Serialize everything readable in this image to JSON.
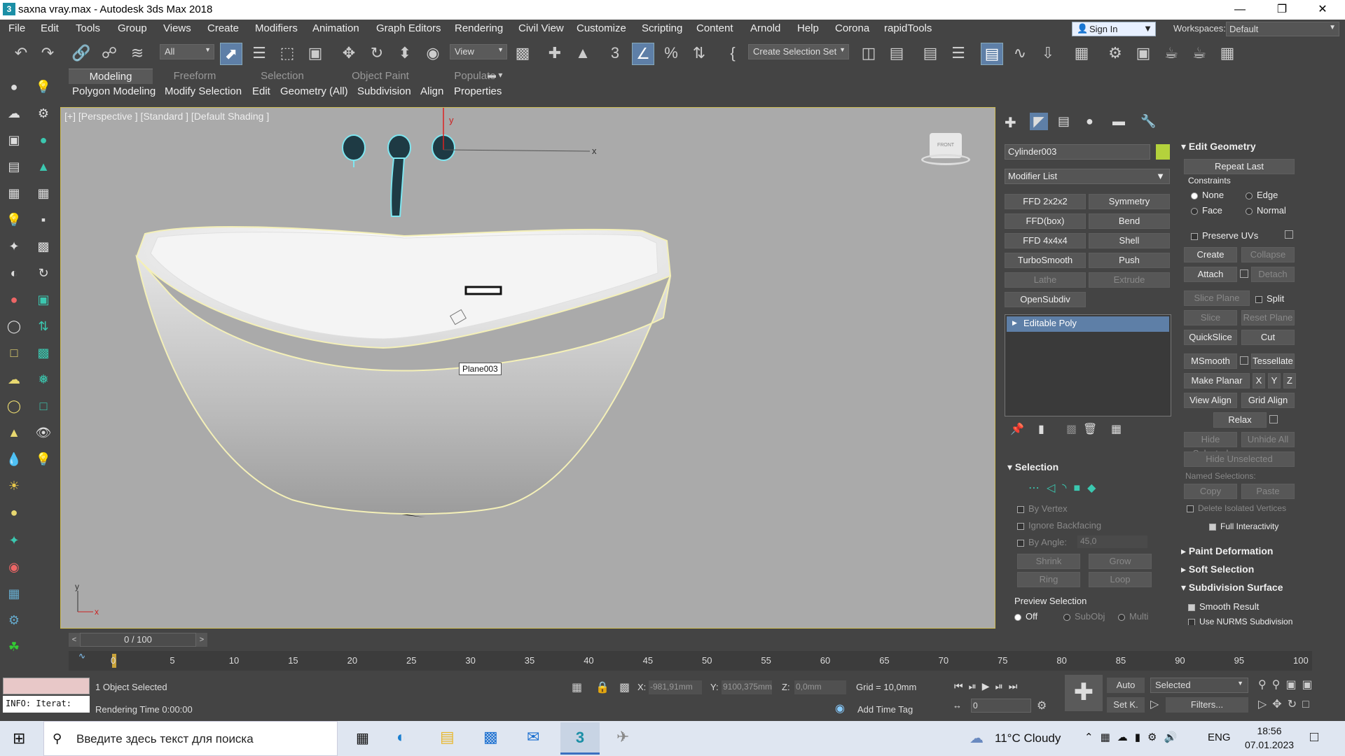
{
  "window": {
    "title": "saxna vray.max - Autodesk 3ds Max 2018",
    "app_logo": "3"
  },
  "menu": [
    "File",
    "Edit",
    "Tools",
    "Group",
    "Views",
    "Create",
    "Modifiers",
    "Animation",
    "Graph Editors",
    "Rendering",
    "Civil View",
    "Customize",
    "Scripting",
    "Content",
    "Arnold",
    "Help",
    "Corona",
    "rapidTools"
  ],
  "signin": "Sign In",
  "workspaces": {
    "label": "Workspaces:",
    "value": "Default"
  },
  "toolbar": {
    "filter": "All",
    "view": "View",
    "selection_set": "Create Selection Set"
  },
  "ribbon": {
    "tabs": [
      "Modeling",
      "Freeform",
      "Selection",
      "Object Paint",
      "Populate"
    ],
    "active": "Modeling",
    "subtabs": [
      "Polygon Modeling",
      "Modify Selection",
      "Edit",
      "Geometry (All)",
      "Subdivision",
      "Align",
      "Properties"
    ]
  },
  "viewport": {
    "label": "[+] [Perspective ] [Standard ] [Default Shading ]",
    "tooltip": "Plane003",
    "axis_y": "y",
    "axis_x": "x",
    "gizmo_y": "y",
    "gizmo_x": "x",
    "viewcube": "FRONT"
  },
  "panel": {
    "object_name": "Cylinder003",
    "object_color": "#b4d23c",
    "modifier_list": "Modifier List",
    "modifier_buttons": [
      {
        "label": "FFD 2x2x2",
        "enabled": true
      },
      {
        "label": "Symmetry",
        "enabled": true
      },
      {
        "label": "FFD(box)",
        "enabled": true
      },
      {
        "label": "Bend",
        "enabled": true
      },
      {
        "label": "FFD 4x4x4",
        "enabled": true
      },
      {
        "label": "Shell",
        "enabled": true
      },
      {
        "label": "TurboSmooth",
        "enabled": true
      },
      {
        "label": "Push",
        "enabled": true
      },
      {
        "label": "Lathe",
        "enabled": false
      },
      {
        "label": "Extrude",
        "enabled": false
      },
      {
        "label": "OpenSubdiv",
        "enabled": true
      }
    ],
    "stack_item": "Editable Poly",
    "selection": {
      "title": "Selection",
      "by_vertex": "By Vertex",
      "ignore_backfacing": "Ignore Backfacing",
      "by_angle": "By Angle:",
      "angle": "45,0",
      "shrink": "Shrink",
      "grow": "Grow",
      "ring": "Ring",
      "loop": "Loop",
      "preview": "Preview Selection",
      "off": "Off",
      "subobj": "SubObj",
      "multi": "Multi"
    },
    "edit_geometry": {
      "title": "Edit Geometry",
      "repeat_last": "Repeat Last",
      "constraints": "Constraints",
      "none": "None",
      "edge": "Edge",
      "face": "Face",
      "normal": "Normal",
      "preserve_uvs": "Preserve UVs",
      "create": "Create",
      "collapse": "Collapse",
      "attach": "Attach",
      "detach": "Detach",
      "slice_plane": "Slice Plane",
      "split": "Split",
      "slice": "Slice",
      "reset_plane": "Reset Plane",
      "quickslice": "QuickSlice",
      "cut": "Cut",
      "msmooth": "MSmooth",
      "tessellate": "Tessellate",
      "make_planar": "Make Planar",
      "x": "X",
      "y": "Y",
      "z": "Z",
      "view_align": "View Align",
      "grid_align": "Grid Align",
      "relax": "Relax",
      "hide_selected": "Hide Selected",
      "unhide_all": "Unhide All",
      "hide_unselected": "Hide Unselected",
      "named_selections": "Named Selections:",
      "copy": "Copy",
      "paste": "Paste",
      "delete_isolated": "Delete Isolated Vertices",
      "full_interactivity": "Full Interactivity"
    },
    "rollouts": [
      "Paint Deformation",
      "Soft Selection",
      "Subdivision Surface"
    ],
    "smooth_result": "Smooth Result",
    "nurms_partial": "Use NURMS Subdivision"
  },
  "timeline": {
    "frame": "0 / 100",
    "ticks": [
      "0",
      "5",
      "10",
      "15",
      "20",
      "25",
      "30",
      "35",
      "40",
      "45",
      "50",
      "55",
      "60",
      "65",
      "70",
      "75",
      "80",
      "85",
      "90",
      "95",
      "100"
    ]
  },
  "status": {
    "selected": "1 Object Selected",
    "render_time": "Rendering Time  0:00:00",
    "maxscript": "INFO: Iterat:",
    "x_label": "X:",
    "x": "-981,91mm",
    "y_label": "Y:",
    "y": "9100,375mm",
    "z_label": "Z:",
    "z": "0,0mm",
    "grid": "Grid = 10,0mm",
    "add_time_tag": "Add Time Tag",
    "auto": "Auto",
    "setk": "Set K.",
    "selected_dd": "Selected",
    "filters": "Filters...",
    "frame": "0"
  },
  "taskbar": {
    "search": "Введите здесь текст для поиска",
    "weather": "11°C  Cloudy",
    "lang": "ENG",
    "time": "18:56",
    "date": "07.01.2023"
  }
}
